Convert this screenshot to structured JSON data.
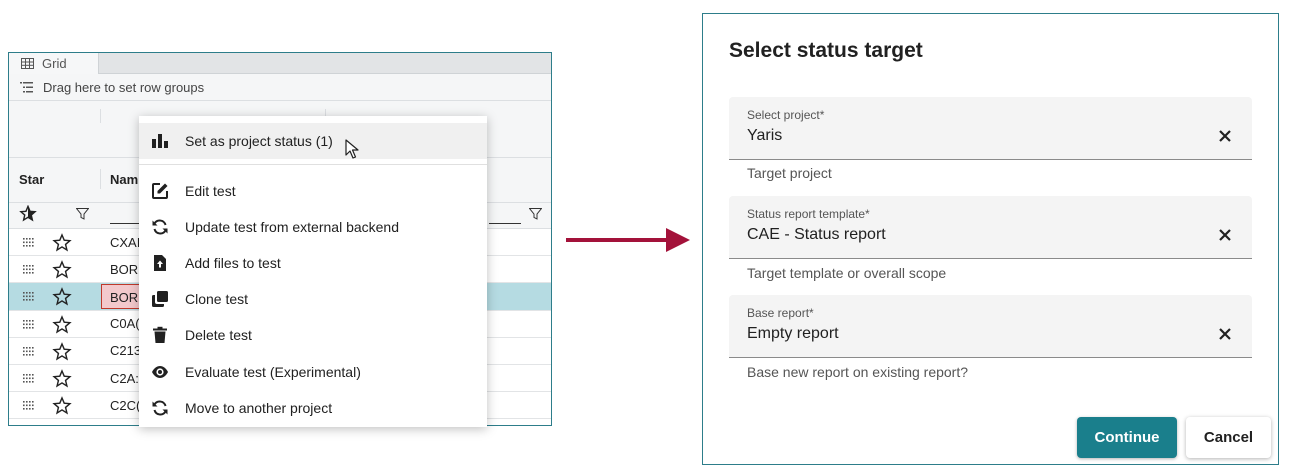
{
  "grid": {
    "tab_label": "Grid",
    "group_bar_text": "Drag here to set row groups",
    "columns": {
      "star": "Star",
      "name": "Nam"
    },
    "rows": [
      {
        "name": "CXAI",
        "selected": false
      },
      {
        "name": "BORI",
        "selected": false
      },
      {
        "name": "BOR",
        "selected": true
      },
      {
        "name": "C0A(",
        "selected": false
      },
      {
        "name": "C213",
        "selected": false
      },
      {
        "name": "C2A:",
        "selected": false
      },
      {
        "name": "C2C(",
        "selected": false
      }
    ]
  },
  "context_menu": {
    "items": [
      {
        "label": "Set as project status (1)",
        "icon": "bar-chart-icon"
      },
      {
        "label": "Edit test",
        "icon": "edit-icon"
      },
      {
        "label": "Update test from external backend",
        "icon": "refresh-icon"
      },
      {
        "label": "Add files to test",
        "icon": "file-upload-icon"
      },
      {
        "label": "Clone test",
        "icon": "clone-icon"
      },
      {
        "label": "Delete test",
        "icon": "trash-icon"
      },
      {
        "label": "Evaluate test (Experimental)",
        "icon": "eye-icon"
      },
      {
        "label": "Move to another project",
        "icon": "refresh-icon"
      }
    ]
  },
  "dialog": {
    "title": "Select status target",
    "fields": [
      {
        "label": "Select project*",
        "value": "Yaris",
        "helper": "Target project"
      },
      {
        "label": "Status report template*",
        "value": "CAE - Status report",
        "helper": "Target template or overall scope"
      },
      {
        "label": "Base report*",
        "value": "Empty report",
        "helper": "Base new report on existing report?"
      }
    ],
    "continue_label": "Continue",
    "cancel_label": "Cancel"
  },
  "colors": {
    "accent": "#1a7f8c",
    "arrow": "#a3123a",
    "selected_row": "#b5dbe2"
  }
}
